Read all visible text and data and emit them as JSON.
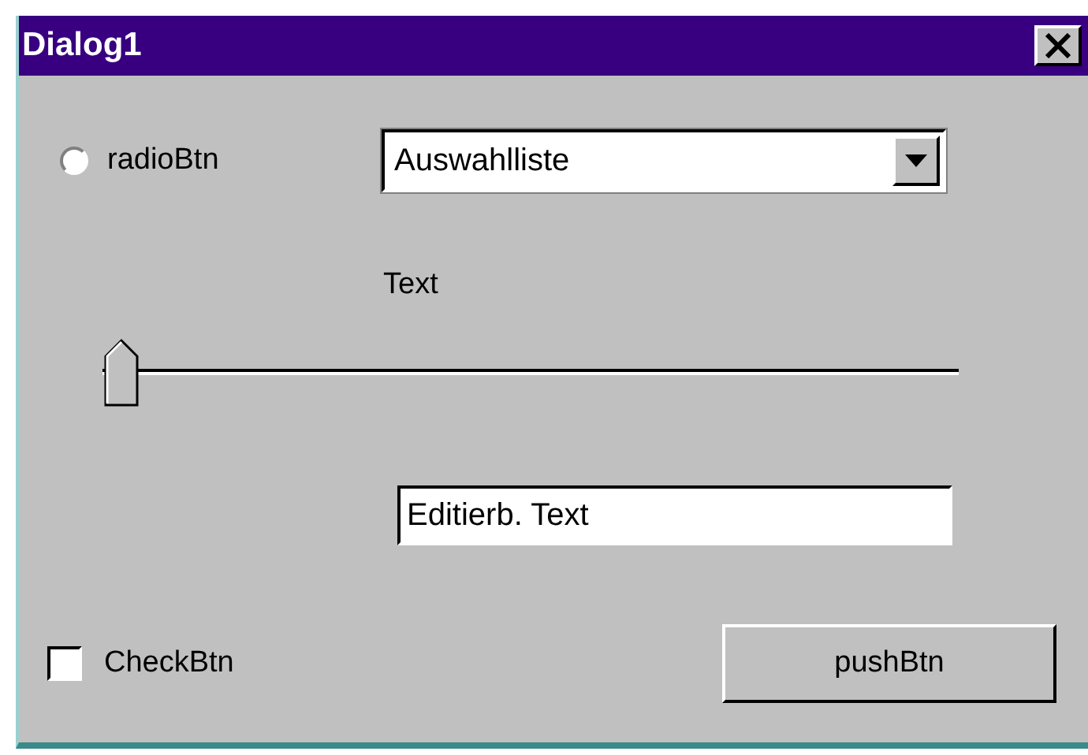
{
  "window": {
    "title": "Dialog1"
  },
  "radio": {
    "label": "radioBtn",
    "selected": false
  },
  "dropdown": {
    "value": "Auswahlliste"
  },
  "slider_label": "Text",
  "slider": {
    "level": 0
  },
  "edit_field": {
    "value": "Editierb. Text"
  },
  "checkbox": {
    "label": "CheckBtn",
    "checked": false
  },
  "button": {
    "label": "pushBtn"
  }
}
